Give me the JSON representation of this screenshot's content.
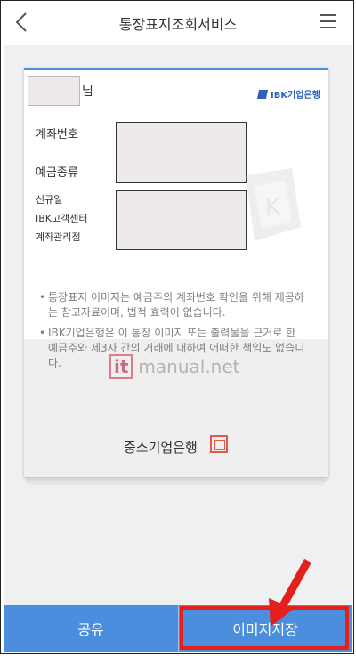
{
  "header": {
    "title": "통장표지조회서비스",
    "back_icon": "chevron-left-icon",
    "menu_icon": "hamburger-menu-icon"
  },
  "card": {
    "name_suffix": "님",
    "bank_logo_text": "IBK기업은행",
    "labels": {
      "account_number": "계좌번호",
      "deposit_type": "예금종류",
      "opened": "신규일",
      "center": "IBK고객센터",
      "branch": "계좌관리점"
    },
    "notes": [
      "통장표지 이미지는 예금주의 계좌번호 확인을 위해 제공하는 참고자료이며, 법적 효력이 없습니다.",
      "IBK기업은행은 이 통장 이미지 또는 출력물을 근거로 한 예금주와 제3자 간의 거래에 대하여 어떠한 책임도 없습니다."
    ],
    "bank_name": "중소기업은행"
  },
  "watermark": {
    "site_it": "it",
    "site_rest": "manual.net"
  },
  "bottom": {
    "share_label": "공유",
    "save_label": "이미지저장"
  },
  "colors": {
    "primary_blue": "#4c8ede",
    "highlight_red": "#e3201c",
    "seal_red": "#e35a4d",
    "logo_blue": "#2c63b5"
  }
}
